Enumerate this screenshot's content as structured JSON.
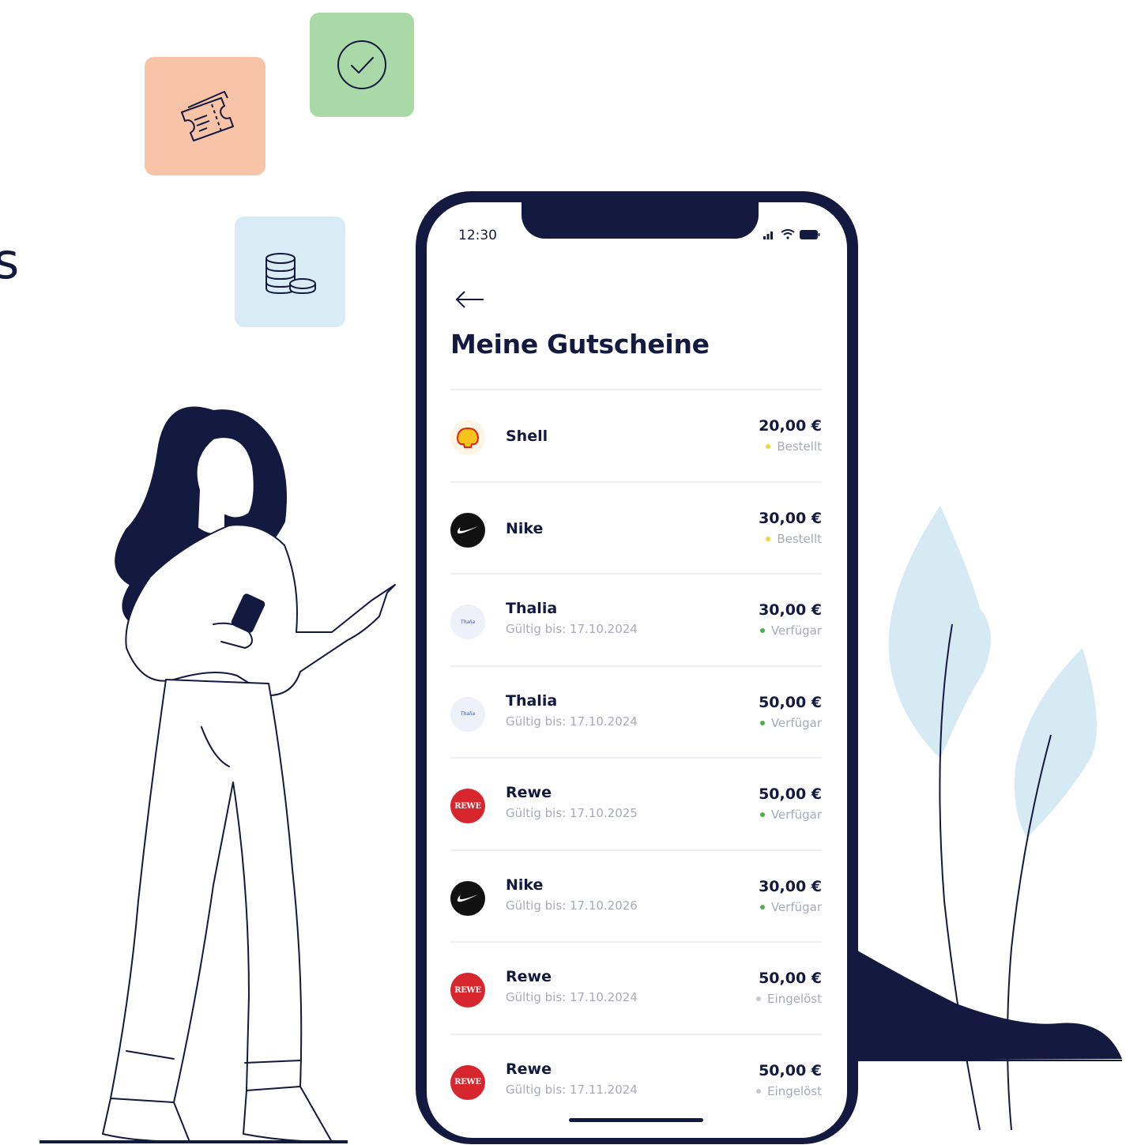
{
  "left_fragment": "s",
  "phone": {
    "status_time": "12:30",
    "title": "Meine Gutscheine",
    "vouchers": [
      {
        "brand": "Shell",
        "logo": "shell",
        "validity": "",
        "amount": "20,00 €",
        "status": "Bestellt",
        "status_color": "#f2d33b"
      },
      {
        "brand": "Nike",
        "logo": "nike",
        "validity": "",
        "amount": "30,00 €",
        "status": "Bestellt",
        "status_color": "#f2d33b"
      },
      {
        "brand": "Thalia",
        "logo": "thalia",
        "validity": "Gültig bis: 17.10.2024",
        "amount": "30,00 €",
        "status": "Verfügar",
        "status_color": "#4caf50"
      },
      {
        "brand": "Thalia",
        "logo": "thalia",
        "validity": "Gültig bis: 17.10.2024",
        "amount": "50,00 €",
        "status": "Verfügar",
        "status_color": "#4caf50"
      },
      {
        "brand": "Rewe",
        "logo": "rewe",
        "validity": "Gültig bis: 17.10.2025",
        "amount": "50,00 €",
        "status": "Verfügar",
        "status_color": "#4caf50"
      },
      {
        "brand": "Nike",
        "logo": "nike",
        "validity": "Gültig bis: 17.10.2026",
        "amount": "30,00 €",
        "status": "Verfügar",
        "status_color": "#4caf50"
      },
      {
        "brand": "Rewe",
        "logo": "rewe",
        "validity": "Gültig bis: 17.10.2024",
        "amount": "50,00 €",
        "status": "Eingelöst",
        "status_color": "#c4c7d2"
      },
      {
        "brand": "Rewe",
        "logo": "rewe",
        "validity": "Gültig bis: 17.11.2024",
        "amount": "50,00 €",
        "status": "Eingelöst",
        "status_color": "#c4c7d2"
      }
    ]
  },
  "logo_text": {
    "thalia": "Thalia",
    "rewe": "REWE"
  },
  "colors": {
    "navy": "#14193f",
    "ticket_tile": "#f8c4a8",
    "check_tile": "#a9d9a7",
    "coins_tile": "#d9ecf5",
    "leaf": "#d6eaf3"
  },
  "icons": [
    "ticket-icon",
    "check-circle-icon",
    "coins-icon",
    "back-arrow-icon",
    "signal-icon",
    "wifi-icon",
    "battery-icon"
  ]
}
